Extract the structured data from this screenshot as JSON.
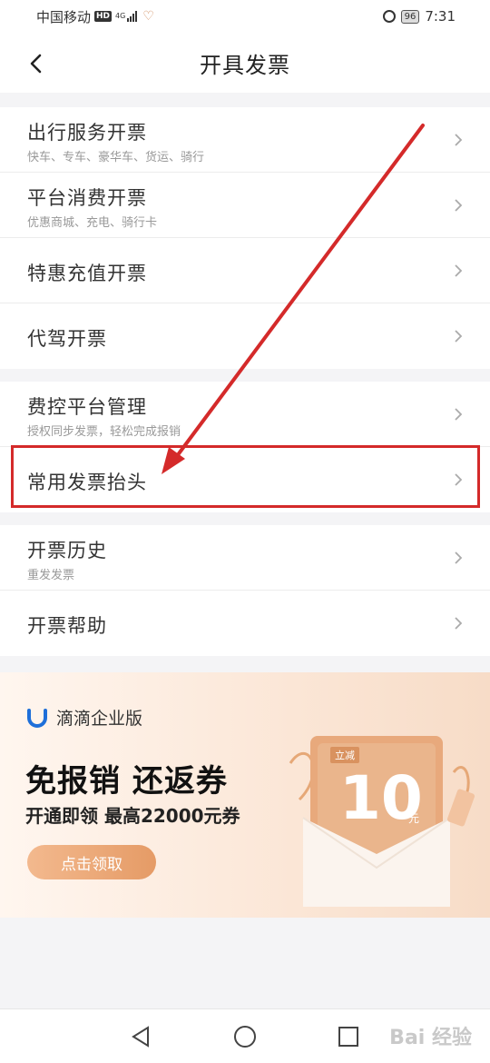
{
  "status_bar": {
    "carrier": "中国移动",
    "hd_badge": "HD",
    "network": "4G",
    "battery": "96",
    "time": "7:31"
  },
  "header": {
    "title": "开具发票"
  },
  "groups": [
    {
      "items": [
        {
          "title": "出行服务开票",
          "subtitle": "快车、专车、豪华车、货运、骑行"
        },
        {
          "title": "平台消费开票",
          "subtitle": "优惠商城、充电、骑行卡"
        },
        {
          "title": "特惠充值开票",
          "subtitle": ""
        },
        {
          "title": "代驾开票",
          "subtitle": ""
        }
      ]
    },
    {
      "items": [
        {
          "title": "费控平台管理",
          "subtitle": "授权同步发票，轻松完成报销"
        },
        {
          "title": "常用发票抬头",
          "subtitle": ""
        }
      ]
    },
    {
      "items": [
        {
          "title": "开票历史",
          "subtitle": "重发发票"
        },
        {
          "title": "开票帮助",
          "subtitle": ""
        }
      ]
    }
  ],
  "promo": {
    "brand": "滴滴企业版",
    "headline": "免报销 还返券",
    "subline": "开通即领 最高22000元券",
    "cta": "点击领取",
    "coupon_label": "立减",
    "coupon_value": "10",
    "coupon_unit": "元"
  },
  "watermark": "Bai 经验",
  "colors": {
    "accent": "#e59b66",
    "highlight": "#d42a2a",
    "annotation_arrow": "#d42a2a"
  }
}
